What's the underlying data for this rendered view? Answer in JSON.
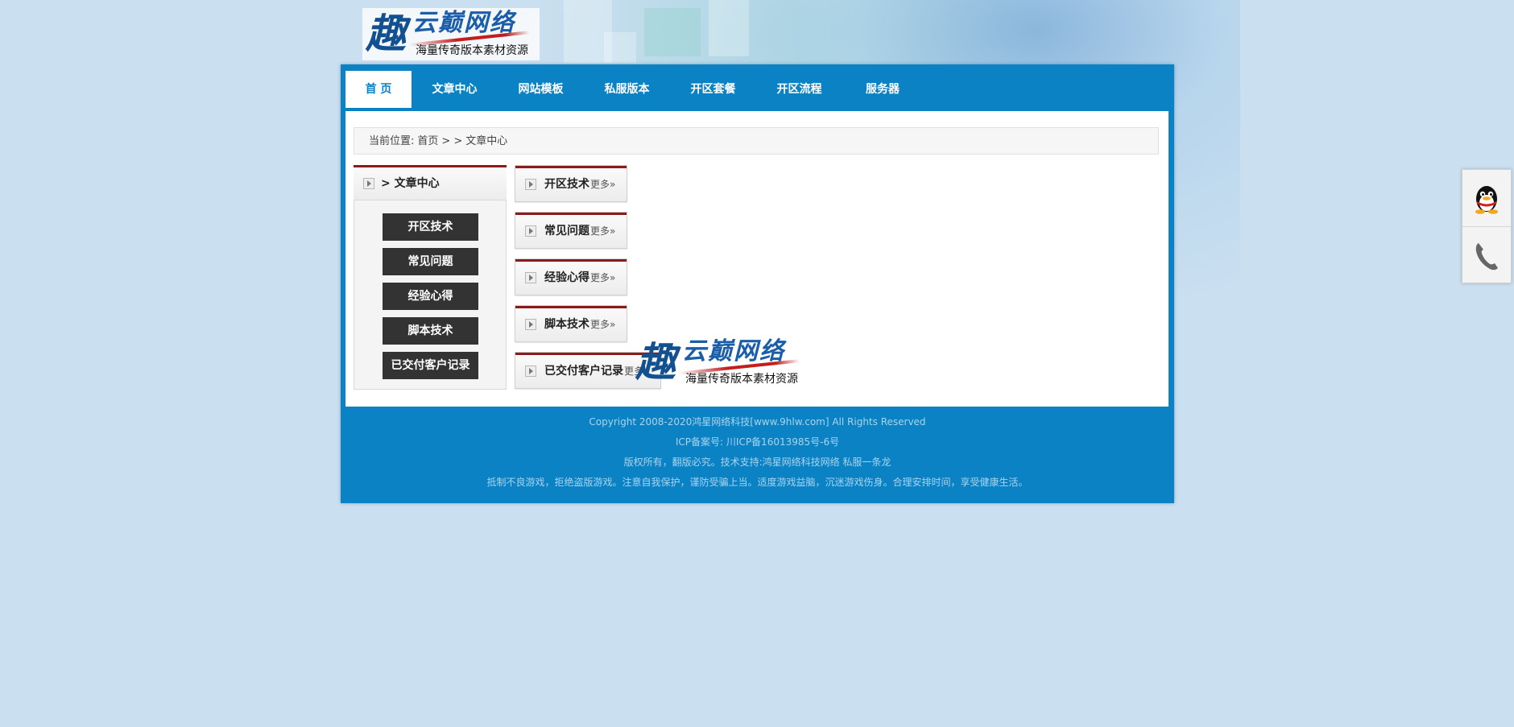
{
  "logo": {
    "brush_char": "趣",
    "main_text": "云巅网络",
    "sub_text": "海量传奇版本素材资源"
  },
  "nav": {
    "items": [
      {
        "label": "首 页",
        "active": true
      },
      {
        "label": "文章中心",
        "active": false
      },
      {
        "label": "网站模板",
        "active": false
      },
      {
        "label": "私服版本",
        "active": false
      },
      {
        "label": "开区套餐",
        "active": false
      },
      {
        "label": "开区流程",
        "active": false
      },
      {
        "label": "服务器",
        "active": false
      }
    ]
  },
  "breadcrumb": {
    "prefix": "当前位置:",
    "home": "首页",
    "sep1": ">",
    "sep2": ">",
    "current": "文章中心"
  },
  "sidebar": {
    "title": "> 文章中心",
    "buttons": [
      "开区技术",
      "常见问题",
      "经验心得",
      "脚本技术",
      "已交付客户记录"
    ]
  },
  "categories": {
    "more_label": "更多»",
    "items": [
      "开区技术",
      "常见问题",
      "经验心得",
      "脚本技术",
      "已交付客户记录"
    ]
  },
  "footer": {
    "lines": [
      "Copyright 2008-2020鸿星网络科技[www.9hlw.com] All Rights Reserved",
      "ICP备案号: 川ICP备16013985号-6号",
      "版权所有，翻版必究。技术支持:鸿星网络科技网络 私服一条龙",
      "抵制不良游戏，拒绝盗版游戏。注意自我保护，谨防受骗上当。适度游戏益脑，沉迷游戏伤身。合理安排时间，享受健康生活。"
    ]
  },
  "colors": {
    "frame_blue": "#0b82c4",
    "page_bg": "#cadff0",
    "accent_red": "#8b1a1a",
    "button_dark": "#333333"
  },
  "float_contact": {
    "icons": [
      "qq-penguin-icon",
      "phone-icon"
    ]
  }
}
